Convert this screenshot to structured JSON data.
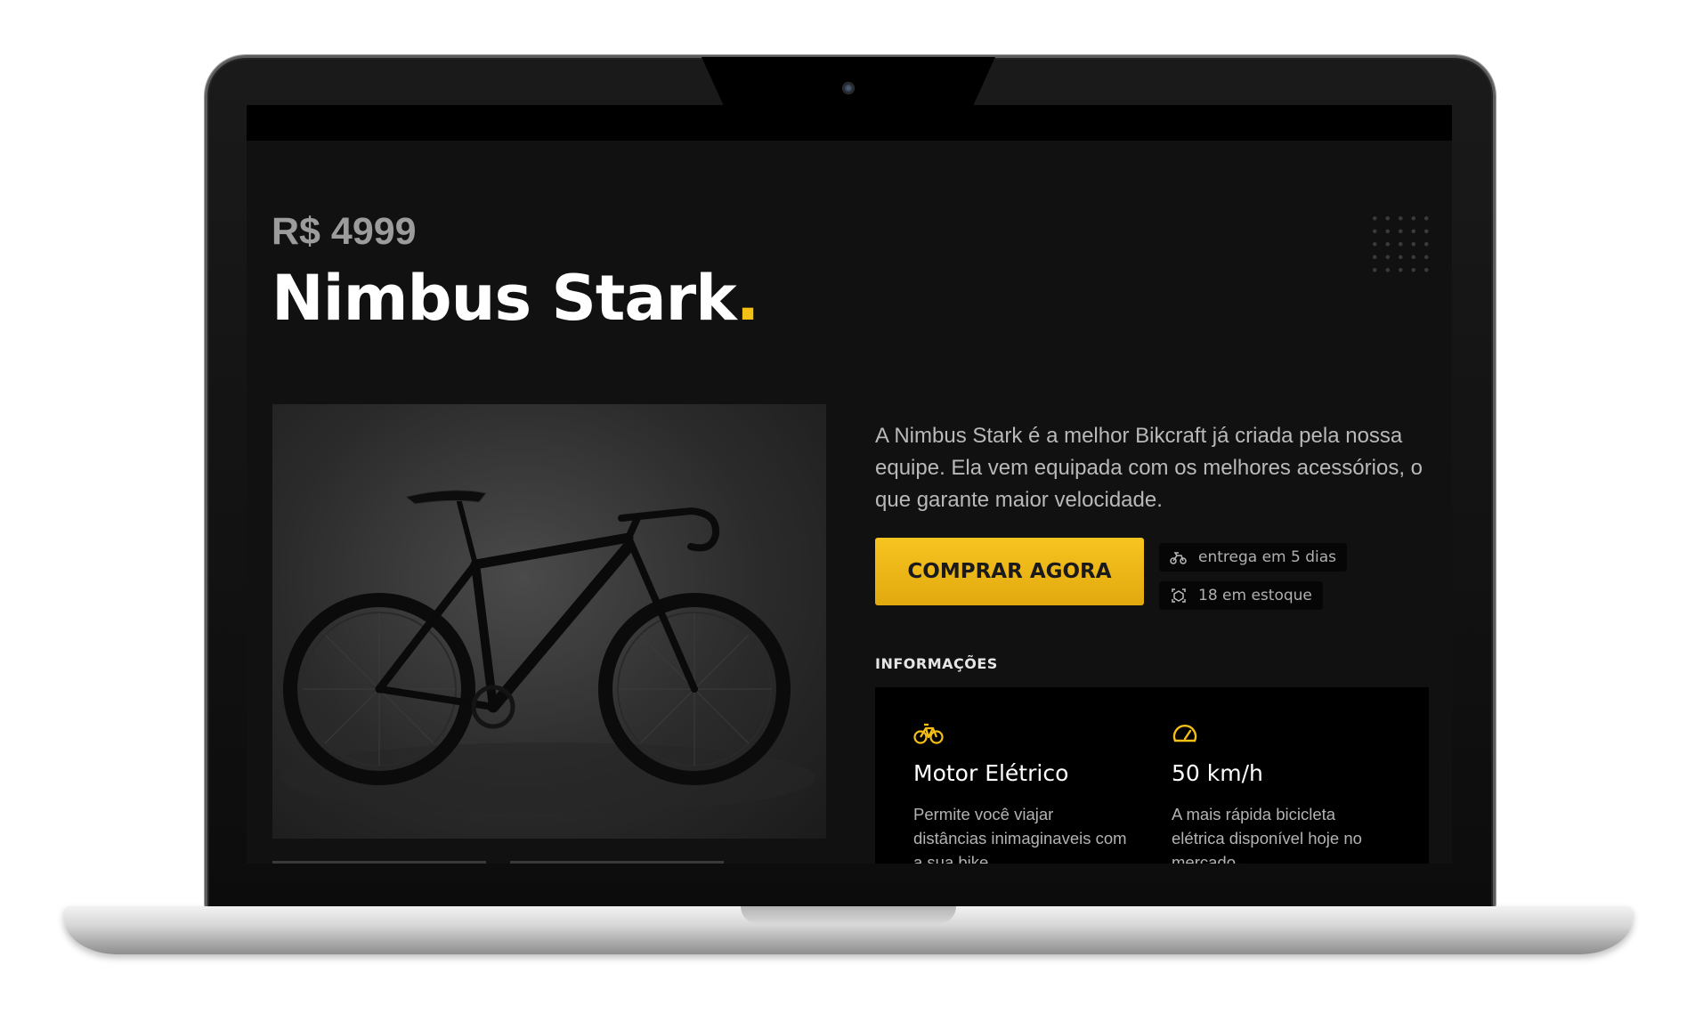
{
  "product": {
    "price": "R$ 4999",
    "name": "Nimbus Stark",
    "name_dot": ".",
    "description": "A Nimbus Stark é a melhor Bikcraft já criada pela nossa equipe. Ela vem equipada com os melhores acessórios, o que garante maior velocidade.",
    "image_alt": "bicicleta"
  },
  "actions": {
    "buy_label": "COMPRAR AGORA"
  },
  "tags": [
    {
      "icon": "delivery-icon",
      "label": "entrega em 5 dias"
    },
    {
      "icon": "stock-icon",
      "label": "18 em estoque"
    }
  ],
  "info": {
    "label": "INFORMAÇÕES",
    "features": [
      {
        "icon": "bike-electric-icon",
        "title": "Motor Elétrico",
        "text": "Permite você viajar distâncias inimaginaveis com a sua bike"
      },
      {
        "icon": "speedometer-icon",
        "title": "50 km/h",
        "text": "A mais rápida bicicleta elétrica disponível hoje no mercado"
      }
    ]
  },
  "colors": {
    "accent": "#f5c016",
    "background": "#111111",
    "panel": "#000000"
  }
}
